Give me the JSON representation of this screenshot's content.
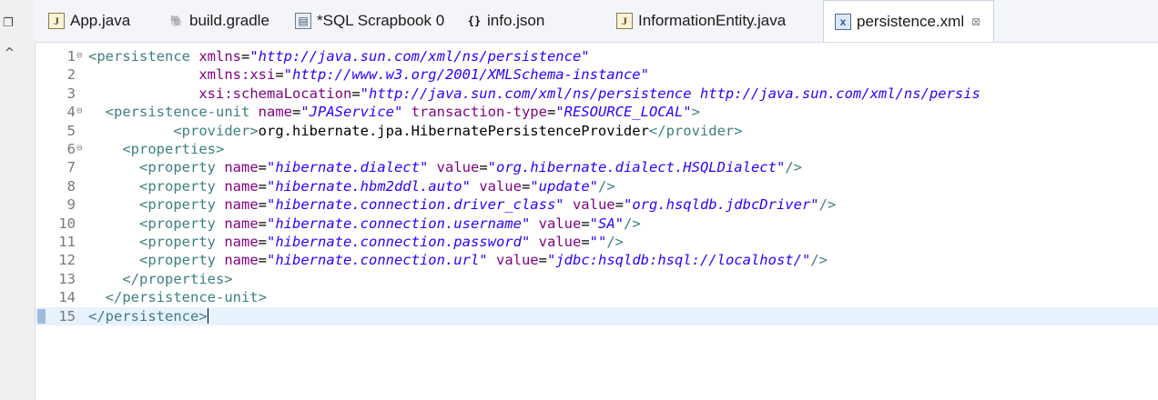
{
  "tabs": [
    {
      "label": "App.java",
      "icon": "java-file-icon"
    },
    {
      "label": "build.gradle",
      "icon": "gradle-file-icon"
    },
    {
      "label": "*SQL Scrapbook 0",
      "icon": "sql-scrapbook-icon"
    },
    {
      "label": "info.json",
      "icon": "json-file-icon"
    },
    {
      "label": "InformationEntity.java",
      "icon": "java-file-icon"
    },
    {
      "label": "persistence.xml",
      "icon": "xml-file-icon",
      "active": true,
      "close": "⊠"
    }
  ],
  "colors": {
    "tag": "#3f7f7f",
    "attribute": "#7f007f",
    "value": "#2a00ff",
    "current_line": "#e8f2fe"
  },
  "editor": {
    "lines": [
      {
        "n": "1",
        "fold": "⊖",
        "parts": [
          [
            "tag",
            "<persistence "
          ],
          [
            "attr",
            "xmlns"
          ],
          [
            "txt",
            "="
          ],
          [
            "val",
            "\"http://java.sun.com/xml/ns/persistence\""
          ]
        ]
      },
      {
        "n": "2",
        "parts": [
          [
            "txt",
            "             "
          ],
          [
            "attr",
            "xmlns:xsi"
          ],
          [
            "txt",
            "="
          ],
          [
            "val",
            "\"http://www.w3.org/2001/XMLSchema-instance\""
          ]
        ]
      },
      {
        "n": "3",
        "parts": [
          [
            "txt",
            "             "
          ],
          [
            "attr",
            "xsi:schemaLocation"
          ],
          [
            "txt",
            "="
          ],
          [
            "val",
            "\"http://java.sun.com/xml/ns/persistence http://java.sun.com/xml/ns/persis"
          ]
        ]
      },
      {
        "n": "4",
        "fold": "⊖",
        "parts": [
          [
            "txt",
            "  "
          ],
          [
            "tag",
            "<persistence-unit "
          ],
          [
            "attr",
            "name"
          ],
          [
            "txt",
            "="
          ],
          [
            "val",
            "\"JPAService\""
          ],
          [
            "txt",
            " "
          ],
          [
            "attr",
            "transaction-type"
          ],
          [
            "txt",
            "="
          ],
          [
            "val",
            "\"RESOURCE_LOCAL\""
          ],
          [
            "tag",
            ">"
          ]
        ]
      },
      {
        "n": "5",
        "parts": [
          [
            "txt",
            "          "
          ],
          [
            "tag",
            "<provider>"
          ],
          [
            "txt",
            "org.hibernate.jpa.HibernatePersistenceProvider"
          ],
          [
            "tag",
            "</provider>"
          ]
        ]
      },
      {
        "n": "6",
        "fold": "⊖",
        "parts": [
          [
            "txt",
            "    "
          ],
          [
            "tag",
            "<properties>"
          ]
        ]
      },
      {
        "n": "7",
        "parts": [
          [
            "txt",
            "      "
          ],
          [
            "tag",
            "<property "
          ],
          [
            "attr",
            "name"
          ],
          [
            "txt",
            "="
          ],
          [
            "val",
            "\"hibernate.dialect\""
          ],
          [
            "txt",
            " "
          ],
          [
            "attr",
            "value"
          ],
          [
            "txt",
            "="
          ],
          [
            "val",
            "\"org.hibernate.dialect.HSQLDialect\""
          ],
          [
            "tag",
            "/>"
          ]
        ]
      },
      {
        "n": "8",
        "parts": [
          [
            "txt",
            "      "
          ],
          [
            "tag",
            "<property "
          ],
          [
            "attr",
            "name"
          ],
          [
            "txt",
            "="
          ],
          [
            "val",
            "\"hibernate.hbm2ddl.auto\""
          ],
          [
            "txt",
            " "
          ],
          [
            "attr",
            "value"
          ],
          [
            "txt",
            "="
          ],
          [
            "val",
            "\"update\""
          ],
          [
            "tag",
            "/>"
          ]
        ]
      },
      {
        "n": "9",
        "parts": [
          [
            "txt",
            "      "
          ],
          [
            "tag",
            "<property "
          ],
          [
            "attr",
            "name"
          ],
          [
            "txt",
            "="
          ],
          [
            "val",
            "\"hibernate.connection.driver_class\""
          ],
          [
            "txt",
            " "
          ],
          [
            "attr",
            "value"
          ],
          [
            "txt",
            "="
          ],
          [
            "val",
            "\"org.hsqldb.jdbcDriver\""
          ],
          [
            "tag",
            "/>"
          ]
        ]
      },
      {
        "n": "10",
        "parts": [
          [
            "txt",
            "      "
          ],
          [
            "tag",
            "<property "
          ],
          [
            "attr",
            "name"
          ],
          [
            "txt",
            "="
          ],
          [
            "val",
            "\"hibernate.connection.username\""
          ],
          [
            "txt",
            " "
          ],
          [
            "attr",
            "value"
          ],
          [
            "txt",
            "="
          ],
          [
            "val",
            "\"SA\""
          ],
          [
            "tag",
            "/>"
          ]
        ]
      },
      {
        "n": "11",
        "parts": [
          [
            "txt",
            "      "
          ],
          [
            "tag",
            "<property "
          ],
          [
            "attr",
            "name"
          ],
          [
            "txt",
            "="
          ],
          [
            "val",
            "\"hibernate.connection.password\""
          ],
          [
            "txt",
            " "
          ],
          [
            "attr",
            "value"
          ],
          [
            "txt",
            "="
          ],
          [
            "val",
            "\"\""
          ],
          [
            "tag",
            "/>"
          ]
        ]
      },
      {
        "n": "12",
        "parts": [
          [
            "txt",
            "      "
          ],
          [
            "tag",
            "<property "
          ],
          [
            "attr",
            "name"
          ],
          [
            "txt",
            "="
          ],
          [
            "val",
            "\"hibernate.connection.url\""
          ],
          [
            "txt",
            " "
          ],
          [
            "attr",
            "value"
          ],
          [
            "txt",
            "="
          ],
          [
            "val",
            "\"jdbc:hsqldb:hsql://localhost/\""
          ],
          [
            "tag",
            "/>"
          ]
        ]
      },
      {
        "n": "13",
        "parts": [
          [
            "txt",
            "    "
          ],
          [
            "tag",
            "</properties>"
          ]
        ]
      },
      {
        "n": "14",
        "parts": [
          [
            "txt",
            "  "
          ],
          [
            "tag",
            "</persistence-unit>"
          ]
        ]
      },
      {
        "n": "15",
        "current": true,
        "parts": [
          [
            "tag",
            "</persistence>"
          ]
        ]
      }
    ]
  }
}
